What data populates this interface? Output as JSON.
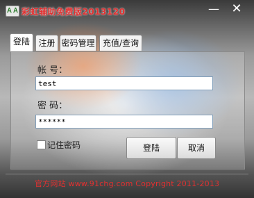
{
  "window": {
    "title": "彩虹辅助免费版2013120",
    "icon": "app-icon",
    "controls": {
      "minimize_glyph": "—",
      "close_glyph": "✕"
    }
  },
  "tabs": [
    {
      "label": "登陆",
      "active": true
    },
    {
      "label": "注册",
      "active": false
    },
    {
      "label": "密码管理",
      "active": false
    },
    {
      "label": "充值/查询",
      "active": false
    }
  ],
  "form": {
    "account_label": "帐  号：",
    "account_value": "test",
    "password_label": "密  码：",
    "password_value": "******",
    "remember_label": "记住密码",
    "remember_checked": false
  },
  "buttons": {
    "login": "登陆",
    "cancel": "取消"
  },
  "footer": {
    "text": "官方网站 www.91chg.com Copyright 2011-2013"
  },
  "colors": {
    "title_red": "#e23030",
    "footer_red": "#e23030"
  }
}
